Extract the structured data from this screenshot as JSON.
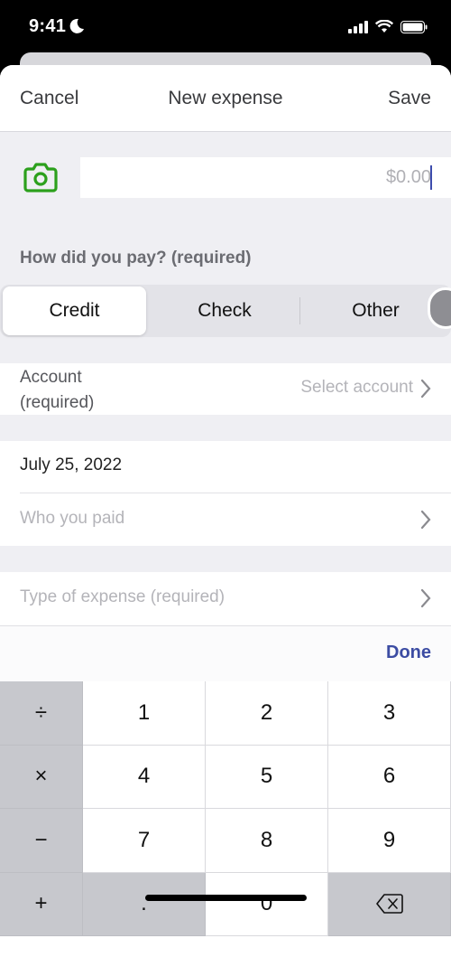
{
  "status_bar": {
    "time": "9:41",
    "icons": [
      "moon-icon",
      "signal-icon",
      "wifi-icon",
      "battery-icon"
    ]
  },
  "nav": {
    "cancel_label": "Cancel",
    "title": "New expense",
    "save_label": "Save"
  },
  "amount": {
    "placeholder": "$0.00",
    "value": ""
  },
  "payment": {
    "label": "How did you pay? (required)",
    "options": [
      "Credit",
      "Check",
      "Other"
    ],
    "selected": "Credit"
  },
  "form": {
    "account_label_line1": "Account",
    "account_label_line2": "(required)",
    "account_value_placeholder": "Select account",
    "date_value": "July 25, 2022",
    "payee_placeholder": "Who you paid",
    "expense_type_placeholder": "Type of expense (required)"
  },
  "toolbar": {
    "done_label": "Done"
  },
  "keypad": {
    "keys": [
      "÷",
      "1",
      "2",
      "3",
      "×",
      "4",
      "5",
      "6",
      "−",
      "7",
      "8",
      "9",
      "+",
      ".",
      "0",
      "delete"
    ]
  },
  "colors": {
    "accent_green": "#2ca01c",
    "done_blue": "#3c4ca3"
  }
}
